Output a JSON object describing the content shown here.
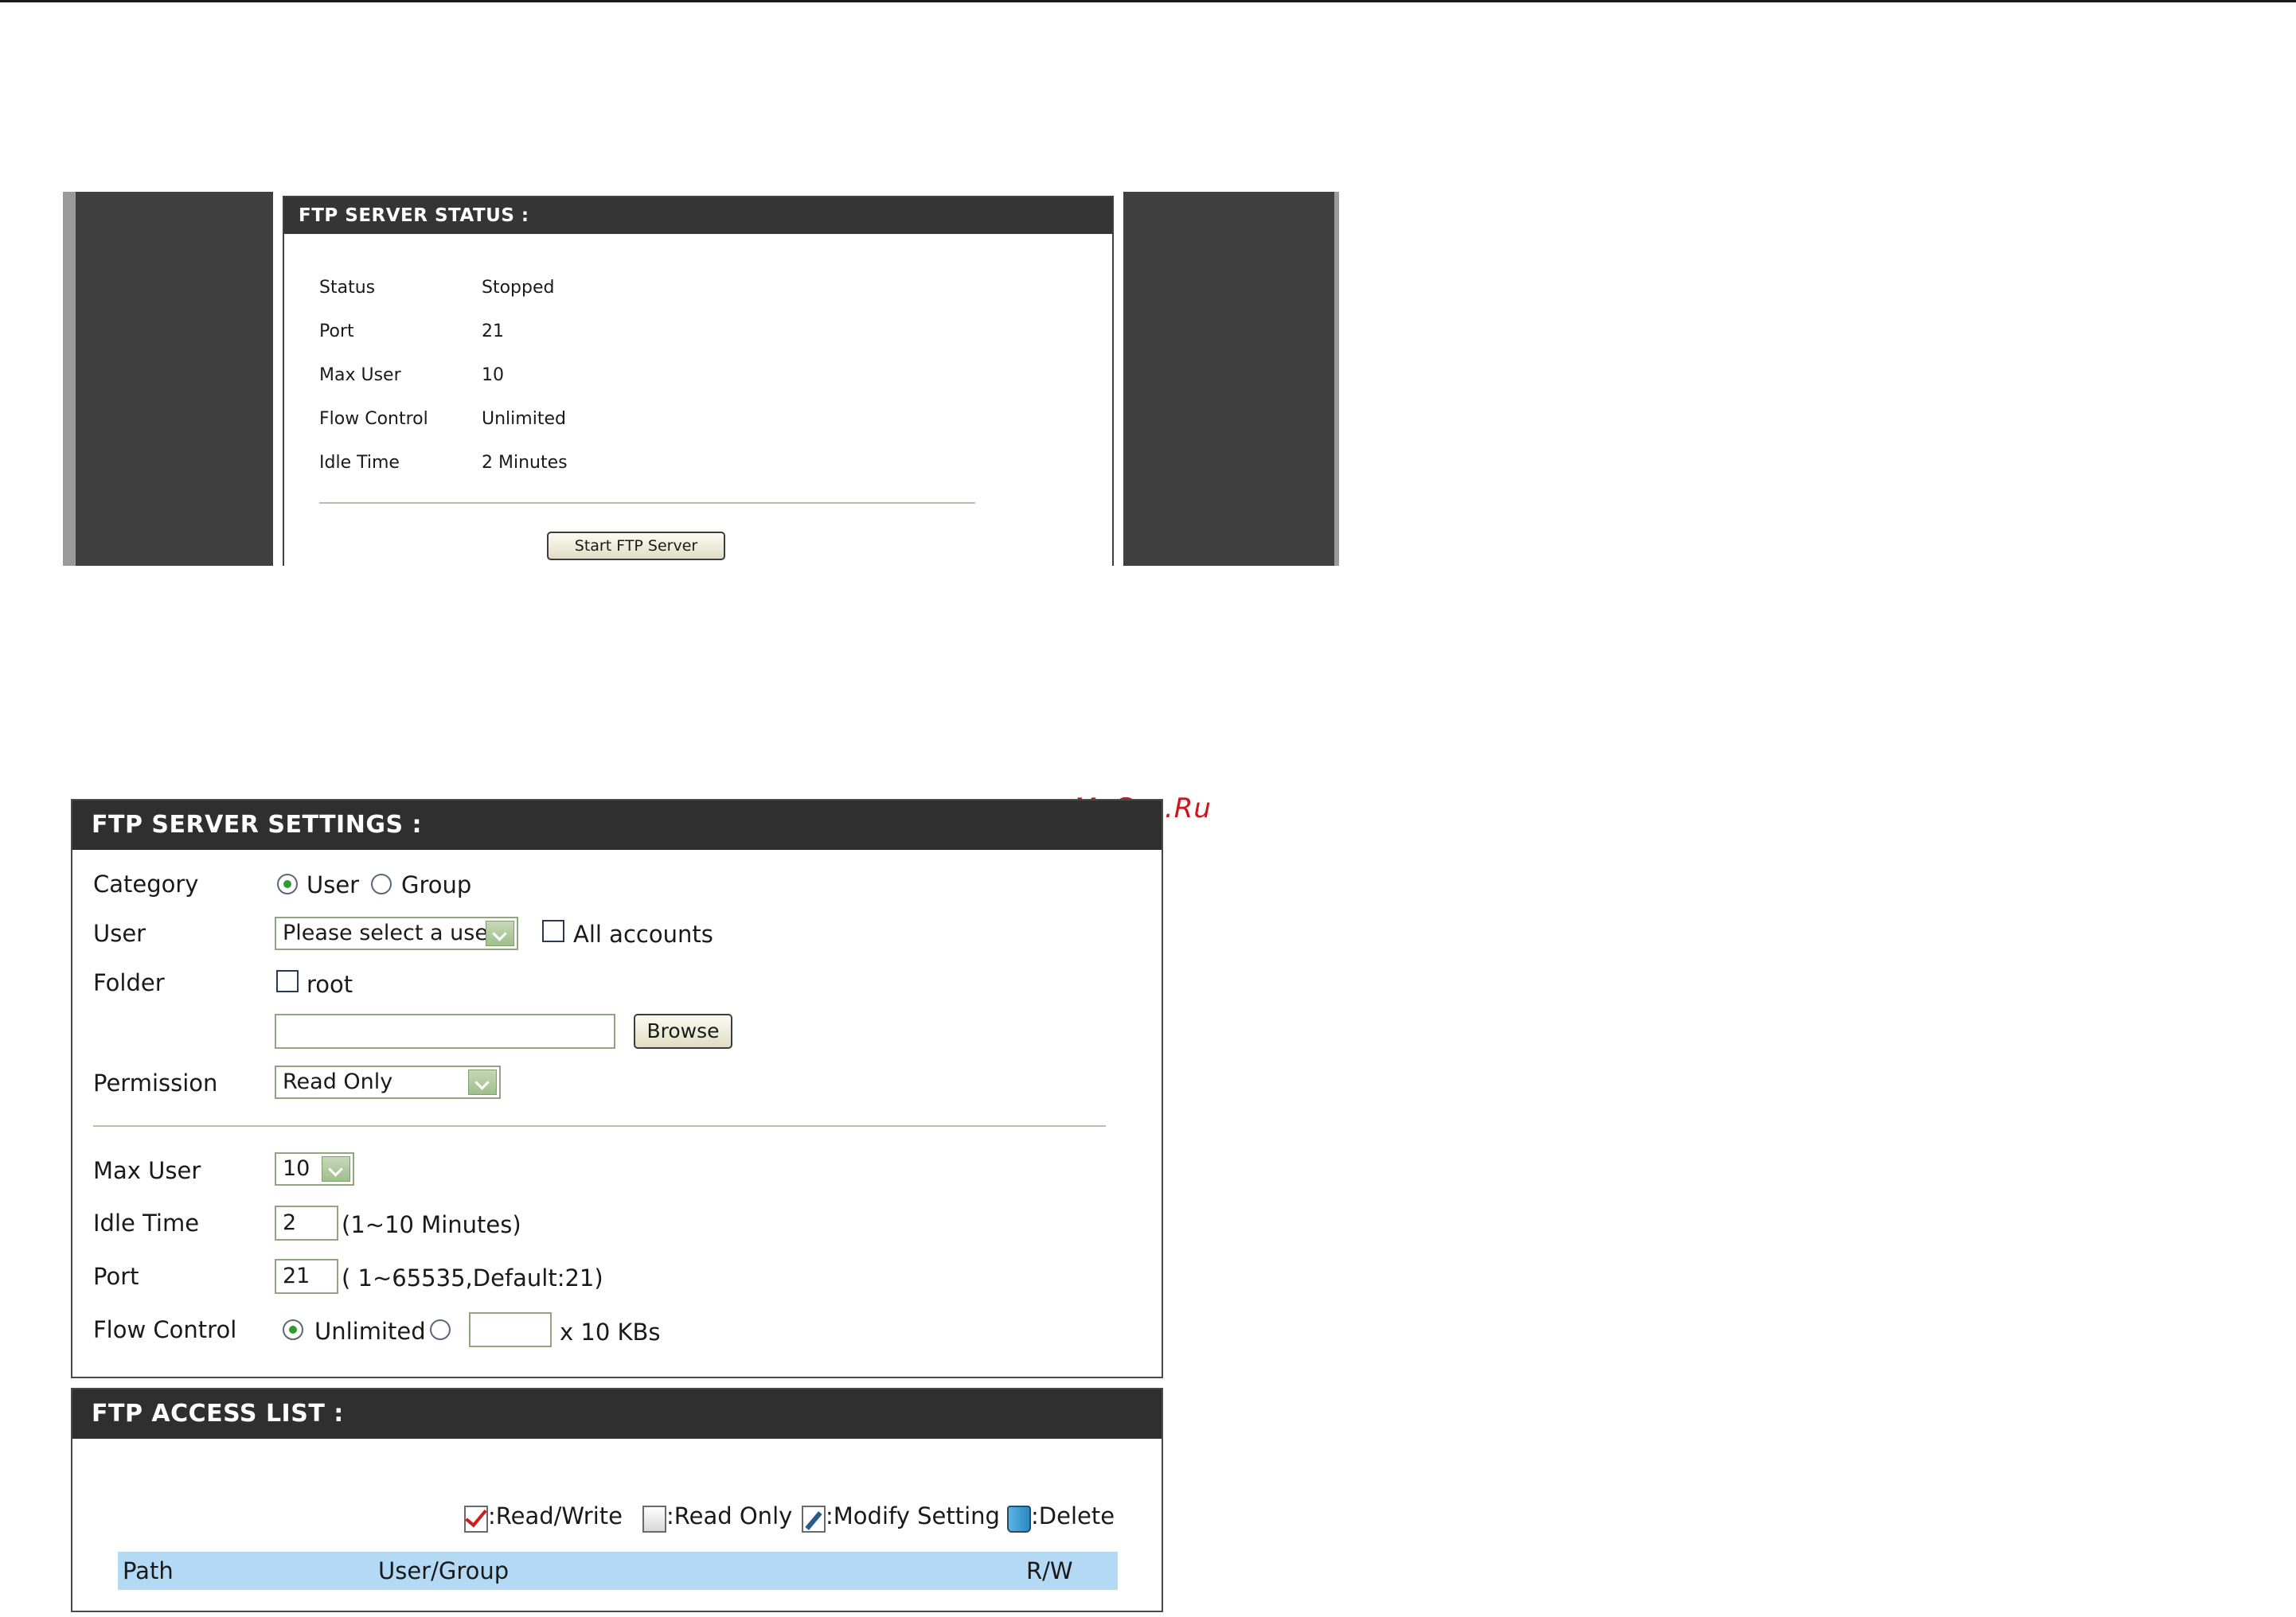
{
  "status_panel": {
    "title": "FTP SERVER STATUS :",
    "rows": [
      {
        "label": "Status",
        "value": "Stopped"
      },
      {
        "label": "Port",
        "value": "21"
      },
      {
        "label": "Max User",
        "value": "10"
      },
      {
        "label": "Flow Control",
        "value": "Unlimited"
      },
      {
        "label": "Idle Time",
        "value": "2 Minutes"
      }
    ],
    "start_button": "Start FTP Server"
  },
  "settings_panel": {
    "title": "FTP SERVER SETTINGS :",
    "category": {
      "label": "Category",
      "options": [
        "User",
        "Group"
      ],
      "selected": "User"
    },
    "user": {
      "label": "User",
      "select_value": "Please select a user",
      "all_accounts_label": "All accounts",
      "all_accounts_checked": false
    },
    "folder": {
      "label": "Folder",
      "root_label": "root",
      "root_checked": false,
      "path_value": "",
      "browse_label": "Browse"
    },
    "permission": {
      "label": "Permission",
      "select_value": "Read Only"
    },
    "max_user": {
      "label": "Max User",
      "select_value": "10"
    },
    "idle_time": {
      "label": "Idle Time",
      "value": "2",
      "hint": "(1~10 Minutes)"
    },
    "port": {
      "label": "Port",
      "value": "21",
      "hint": "( 1~65535,Default:21)"
    },
    "flow_control": {
      "label": "Flow Control",
      "unlimited_label": "Unlimited",
      "selected": "Unlimited",
      "custom_value": "",
      "unit": "x 10 KBs"
    }
  },
  "access_panel": {
    "title": "FTP ACCESS LIST :",
    "legend": [
      {
        "icon": "read-write-icon",
        "label": ":Read/Write"
      },
      {
        "icon": "read-only-icon",
        "label": ":Read Only"
      },
      {
        "icon": "modify-setting-icon",
        "label": ":Modify Setting"
      },
      {
        "icon": "delete-icon",
        "label": ":Delete"
      }
    ],
    "columns": [
      "Path",
      "User/Group",
      "R/W"
    ]
  },
  "watermark": "McGrp.Ru",
  "colors": {
    "header_bg": "#2f2f2f",
    "sidebar_bg": "#404040",
    "table_header_bg": "#b3d9f5",
    "field_border": "#8fa77c",
    "watermark": "#d0141c"
  }
}
